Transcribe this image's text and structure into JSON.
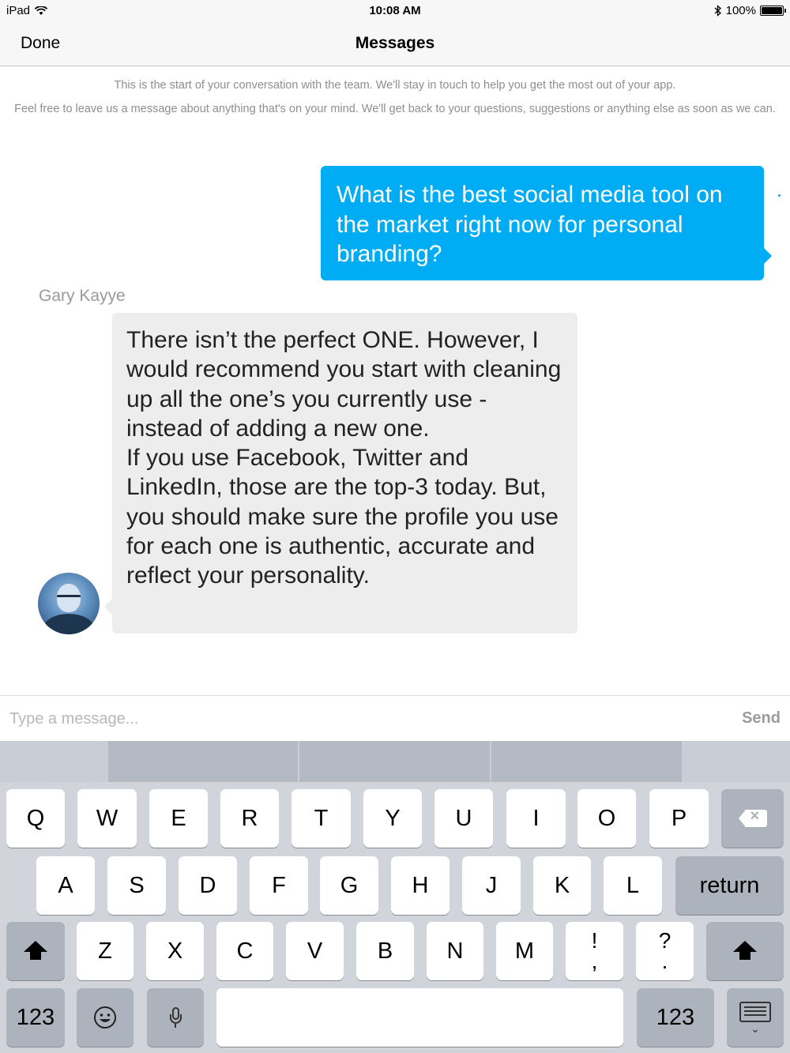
{
  "status_bar": {
    "device": "iPad",
    "time": "10:08 AM",
    "battery": "100%"
  },
  "nav": {
    "done_label": "Done",
    "title": "Messages"
  },
  "conversation": {
    "intro_line1": "This is the start of your conversation with the  team. We'll stay in touch to help you get the most out of your app.",
    "intro_line2": "Feel free to leave us a message about anything that's on your mind. We'll get back to your questions, suggestions or anything else as soon as we can.",
    "messages": [
      {
        "direction": "outgoing",
        "text": "What is the best social media tool on the market right now for personal branding?"
      },
      {
        "direction": "incoming",
        "sender": "Gary Kayye",
        "text": "There isn’t the perfect ONE. However, I would recommend you start with cleaning up all the one’s you currently use - instead of adding a new one.\nIf you use Facebook, Twitter and LinkedIn, those are the top-3 today. But,\nyou should make sure the profile you use for each one is authentic, accurate and reflect your personality."
      }
    ]
  },
  "composer": {
    "placeholder": "Type a message...",
    "send_label": "Send"
  },
  "keyboard": {
    "row1": [
      "Q",
      "W",
      "E",
      "R",
      "T",
      "Y",
      "U",
      "I",
      "O",
      "P"
    ],
    "row2": [
      "A",
      "S",
      "D",
      "F",
      "G",
      "H",
      "J",
      "K",
      "L"
    ],
    "return_label": "return",
    "row3": [
      "Z",
      "X",
      "C",
      "V",
      "B",
      "N",
      "M"
    ],
    "punct1": [
      "!",
      ","
    ],
    "punct2": [
      "?",
      "."
    ],
    "numbers_label": "123",
    "icons": {
      "delete": "backspace-icon",
      "shift": "shift-icon",
      "emoji": "emoji-icon",
      "mic": "microphone-icon",
      "dismiss": "keyboard-dismiss-icon"
    }
  },
  "colors": {
    "outgoing_bubble": "#00adf5",
    "incoming_bubble": "#ededed",
    "keyboard_bg": "#d1d5db"
  }
}
